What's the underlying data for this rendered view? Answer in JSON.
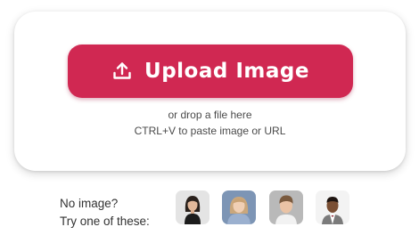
{
  "upload": {
    "button_label": "Upload Image",
    "icon": "upload-icon",
    "accent_color": "#d02852"
  },
  "hints": {
    "drop": "or drop a file here",
    "paste": "CTRL+V to paste image or URL"
  },
  "samples": {
    "line1": "No image?",
    "line2": "Try one of these:",
    "thumbnails": [
      {
        "icon": "sample-woman-photo"
      },
      {
        "icon": "sample-girl-photo"
      },
      {
        "icon": "sample-boy-photo"
      },
      {
        "icon": "sample-child-suit-photo"
      }
    ]
  }
}
